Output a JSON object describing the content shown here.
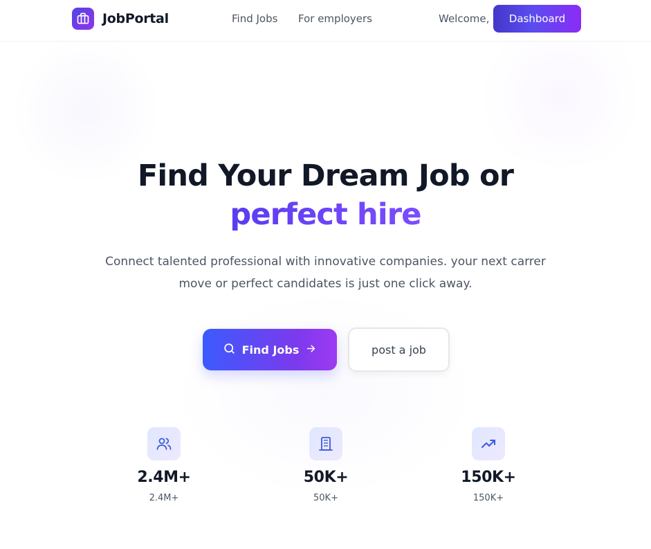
{
  "header": {
    "brand": "JobPortal",
    "nav": [
      "Find Jobs",
      "For employers"
    ],
    "welcome": "Welcome,",
    "dashboard_label": "Dashboard"
  },
  "hero": {
    "title_line1": "Find Your Dream Job or",
    "title_line2": "perfect hire",
    "subtitle": "Connect talented professional with innovative companies. your next carrer move or perfect candidates is just one click away."
  },
  "cta": {
    "find_jobs_label": "Find Jobs",
    "post_job_label": "post a job"
  },
  "stats": [
    {
      "icon": "users-icon",
      "value": "2.4M+",
      "label": "2.4M+"
    },
    {
      "icon": "building-icon",
      "value": "50K+",
      "label": "50K+"
    },
    {
      "icon": "trending-up-icon",
      "value": "150K+",
      "label": "150K+"
    }
  ],
  "colors": {
    "accent_start": "#4338ca",
    "accent_end": "#8b2cf5",
    "headline_highlight": "#6d3cf0",
    "text_primary": "#111827",
    "text_secondary": "#4b5563"
  }
}
